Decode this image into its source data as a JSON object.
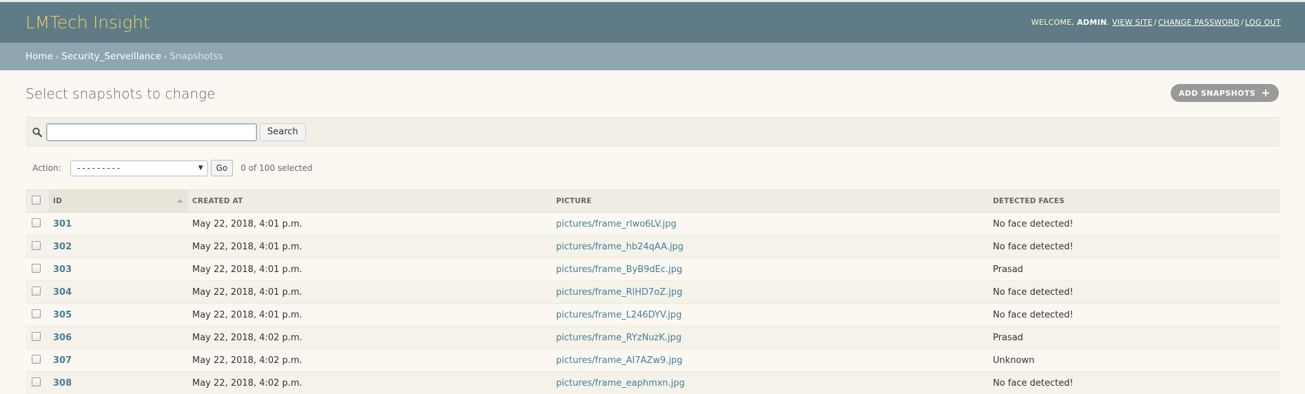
{
  "header": {
    "brand": "LMTech Insight",
    "welcome_prefix": "Welcome,",
    "username": "admin",
    "links": [
      "View site",
      "Change password",
      "Log out"
    ]
  },
  "breadcrumbs": {
    "home": "Home",
    "app": "Security_Serveillance",
    "current": "Snapshotss"
  },
  "page": {
    "title": "Select snapshots to change",
    "add_button": "Add snapshots"
  },
  "search": {
    "value": "",
    "placeholder": "",
    "button_label": "Search"
  },
  "actions": {
    "label": "Action:",
    "selected_value": "---------",
    "go_label": "Go",
    "selected_count": "0 of 100 selected"
  },
  "table": {
    "columns": [
      "ID",
      "Created at",
      "Picture",
      "Detected faces"
    ],
    "rows": [
      {
        "id": "301",
        "created": "May 22, 2018, 4:01 p.m.",
        "picture": "pictures/frame_rlwo6LV.jpg",
        "faces": "No face detected!"
      },
      {
        "id": "302",
        "created": "May 22, 2018, 4:01 p.m.",
        "picture": "pictures/frame_hb24qAA.jpg",
        "faces": "No face detected!"
      },
      {
        "id": "303",
        "created": "May 22, 2018, 4:01 p.m.",
        "picture": "pictures/frame_ByB9dEc.jpg",
        "faces": "Prasad"
      },
      {
        "id": "304",
        "created": "May 22, 2018, 4:01 p.m.",
        "picture": "pictures/frame_RlHD7oZ.jpg",
        "faces": "No face detected!"
      },
      {
        "id": "305",
        "created": "May 22, 2018, 4:01 p.m.",
        "picture": "pictures/frame_L246DYV.jpg",
        "faces": "No face detected!"
      },
      {
        "id": "306",
        "created": "May 22, 2018, 4:02 p.m.",
        "picture": "pictures/frame_RYzNuzK.jpg",
        "faces": "Prasad"
      },
      {
        "id": "307",
        "created": "May 22, 2018, 4:02 p.m.",
        "picture": "pictures/frame_AI7AZw9.jpg",
        "faces": "Unknown"
      },
      {
        "id": "308",
        "created": "May 22, 2018, 4:02 p.m.",
        "picture": "pictures/frame_eaphmxn.jpg",
        "faces": "No face detected!"
      }
    ]
  }
}
